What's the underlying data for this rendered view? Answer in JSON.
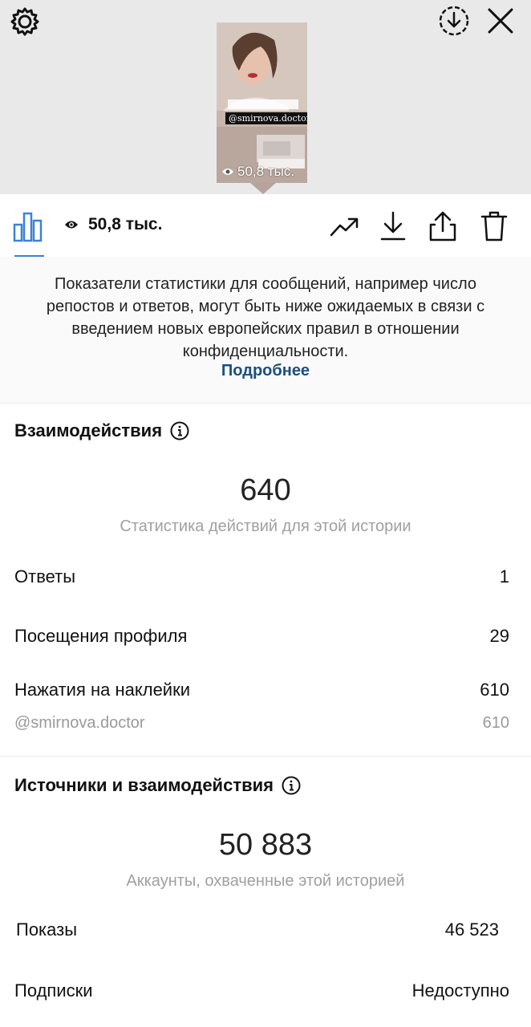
{
  "preview": {
    "tag_text": "@smirnova.doctor",
    "views_overlay": "50,8 тыс."
  },
  "toolbar": {
    "view_count": "50,8 тыс."
  },
  "notice": {
    "text": "Показатели статистики для сообщений, например число репостов и ответов, могут быть ниже ожидаемых в связи с введением новых европейских правил в отношении конфиденциальности.",
    "link": "Подробнее"
  },
  "interactions": {
    "title": "Взаимодействия",
    "total": "640",
    "caption": "Статистика действий для этой истории",
    "rows": [
      {
        "label": "Ответы",
        "value": "1"
      },
      {
        "label": "Посещения профиля",
        "value": "29"
      },
      {
        "label": "Нажатия на наклейки",
        "value": "610"
      }
    ],
    "sticker": {
      "label": "@smirnova.doctor",
      "value": "610"
    }
  },
  "discovery": {
    "title": "Источники и взаимодействия",
    "total": "50 883",
    "caption": "Аккаунты, охваченные этой историей",
    "rows": [
      {
        "label": "Показы",
        "value": "46 523"
      },
      {
        "label": "Подписки",
        "value": "Недоступно"
      }
    ]
  },
  "icons": [
    "gear-icon",
    "save-circle-icon",
    "close-icon",
    "bar-chart-icon",
    "eye-icon",
    "trending-icon",
    "download-icon",
    "share-icon",
    "trash-icon",
    "info-icon"
  ],
  "colors": {
    "link": "#1d4f7c",
    "accent": "#3b82d6",
    "muted": "#a0a0a0"
  }
}
